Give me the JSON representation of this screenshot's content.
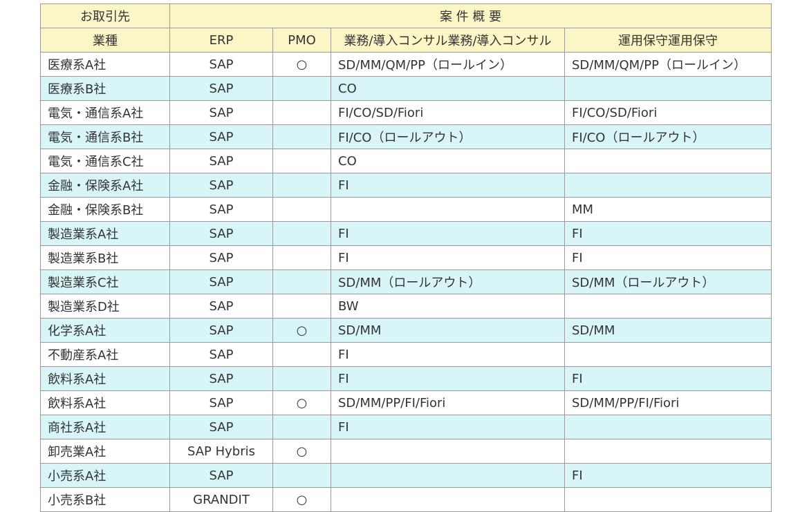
{
  "header": {
    "client": "お取引先",
    "summary": "案 件 概 要",
    "industry": "業種",
    "erp": "ERP",
    "pmo": "PMO",
    "consult": "業務/導入コンサル業務/導入コンサル",
    "maintenance": "運用保守運用保守"
  },
  "rows": [
    {
      "client": "医療系A社",
      "erp": "SAP",
      "pmo": "○",
      "consult": "SD/MM/QM/PP（ロールイン）",
      "maint": "SD/MM/QM/PP（ロールイン）"
    },
    {
      "client": "医療系B社",
      "erp": "SAP",
      "pmo": "",
      "consult": "CO",
      "maint": ""
    },
    {
      "client": "電気・通信系A社",
      "erp": "SAP",
      "pmo": "",
      "consult": "FI/CO/SD/Fiori",
      "maint": "FI/CO/SD/Fiori"
    },
    {
      "client": "電気・通信系B社",
      "erp": "SAP",
      "pmo": "",
      "consult": "FI/CO（ロールアウト）",
      "maint": "FI/CO（ロールアウト）"
    },
    {
      "client": "電気・通信系C社",
      "erp": "SAP",
      "pmo": "",
      "consult": "CO",
      "maint": ""
    },
    {
      "client": "金融・保険系A社",
      "erp": "SAP",
      "pmo": "",
      "consult": "FI",
      "maint": ""
    },
    {
      "client": "金融・保険系B社",
      "erp": "SAP",
      "pmo": "",
      "consult": "",
      "maint": "MM"
    },
    {
      "client": "製造業系A社",
      "erp": "SAP",
      "pmo": "",
      "consult": "FI",
      "maint": "FI"
    },
    {
      "client": "製造業系B社",
      "erp": "SAP",
      "pmo": "",
      "consult": "FI",
      "maint": "FI"
    },
    {
      "client": "製造業系C社",
      "erp": "SAP",
      "pmo": "",
      "consult": "SD/MM（ロールアウト）",
      "maint": "SD/MM（ロールアウト）"
    },
    {
      "client": "製造業系D社",
      "erp": "SAP",
      "pmo": "",
      "consult": "BW",
      "maint": ""
    },
    {
      "client": "化学系A社",
      "erp": "SAP",
      "pmo": "○",
      "consult": "SD/MM",
      "maint": "SD/MM"
    },
    {
      "client": "不動産系A社",
      "erp": "SAP",
      "pmo": "",
      "consult": "FI",
      "maint": ""
    },
    {
      "client": "飲料系A社",
      "erp": "SAP",
      "pmo": "",
      "consult": "FI",
      "maint": "FI"
    },
    {
      "client": "飲料系A社",
      "erp": "SAP",
      "pmo": "○",
      "consult": "SD/MM/PP/FI/Fiori",
      "maint": "SD/MM/PP/FI/Fiori"
    },
    {
      "client": "商社系A社",
      "erp": "SAP",
      "pmo": "",
      "consult": "FI",
      "maint": ""
    },
    {
      "client": "卸売業A社",
      "erp": "SAP Hybris",
      "pmo": "○",
      "consult": "",
      "maint": ""
    },
    {
      "client": "小売系A社",
      "erp": "SAP",
      "pmo": "",
      "consult": "",
      "maint": "FI"
    },
    {
      "client": "小売系B社",
      "erp": "GRANDIT",
      "pmo": "○",
      "consult": "",
      "maint": ""
    }
  ]
}
